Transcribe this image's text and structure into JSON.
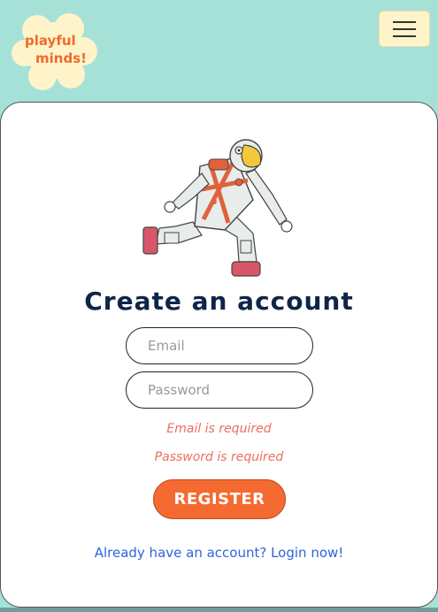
{
  "header": {
    "logo_line1": "playful",
    "logo_line2": "minds!",
    "menu_icon": "hamburger-menu-icon"
  },
  "illustration": {
    "name": "astronaut-illustration"
  },
  "form": {
    "title": "Create an account",
    "email_placeholder": "Email",
    "password_placeholder": "Password",
    "email_error": "Email is required",
    "password_error": "Password is required",
    "register_label": "REGISTER",
    "login_link": "Already have an account? Login now!"
  },
  "colors": {
    "background": "#a6e1d8",
    "logo_flower": "#fff4c9",
    "logo_text": "#f2692e",
    "title": "#0f2548",
    "error": "#ee6e5e",
    "button": "#f56a30",
    "link": "#2e65d9"
  }
}
